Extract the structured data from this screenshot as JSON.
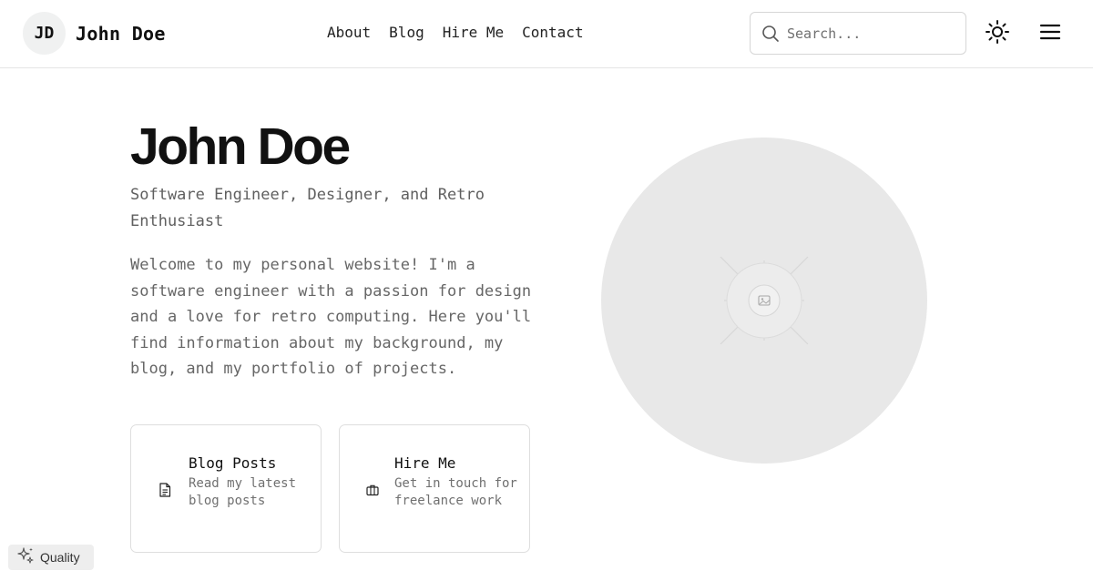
{
  "header": {
    "initials": "JD",
    "name": "John Doe",
    "nav": [
      "About",
      "Blog",
      "Hire Me",
      "Contact"
    ],
    "search_placeholder": "Search...",
    "icons": {
      "search": "search-icon",
      "theme": "sun-icon",
      "menu": "hamburger-menu-icon"
    }
  },
  "hero": {
    "title": "John Doe",
    "subtitle": "Software Engineer, Designer, and Retro Enthusiast",
    "intro": "Welcome to my personal website! I'm a software engineer with a passion for design and a love for retro computing. Here you'll find information about my background, my blog, and my portfolio of projects."
  },
  "cards": [
    {
      "title": "Blog Posts",
      "desc": "Read my latest blog posts",
      "icon": "document-icon"
    },
    {
      "title": "Hire Me",
      "desc": "Get in touch for freelance work",
      "icon": "briefcase-icon"
    }
  ],
  "image": {
    "icon": "image-placeholder-icon"
  },
  "badge": {
    "label": "Quality",
    "icon": "sparkles-icon"
  },
  "colors": {
    "text": "#111111",
    "muted": "#666666",
    "border": "#dedede",
    "placeholder_bg": "#e8e8e8"
  }
}
